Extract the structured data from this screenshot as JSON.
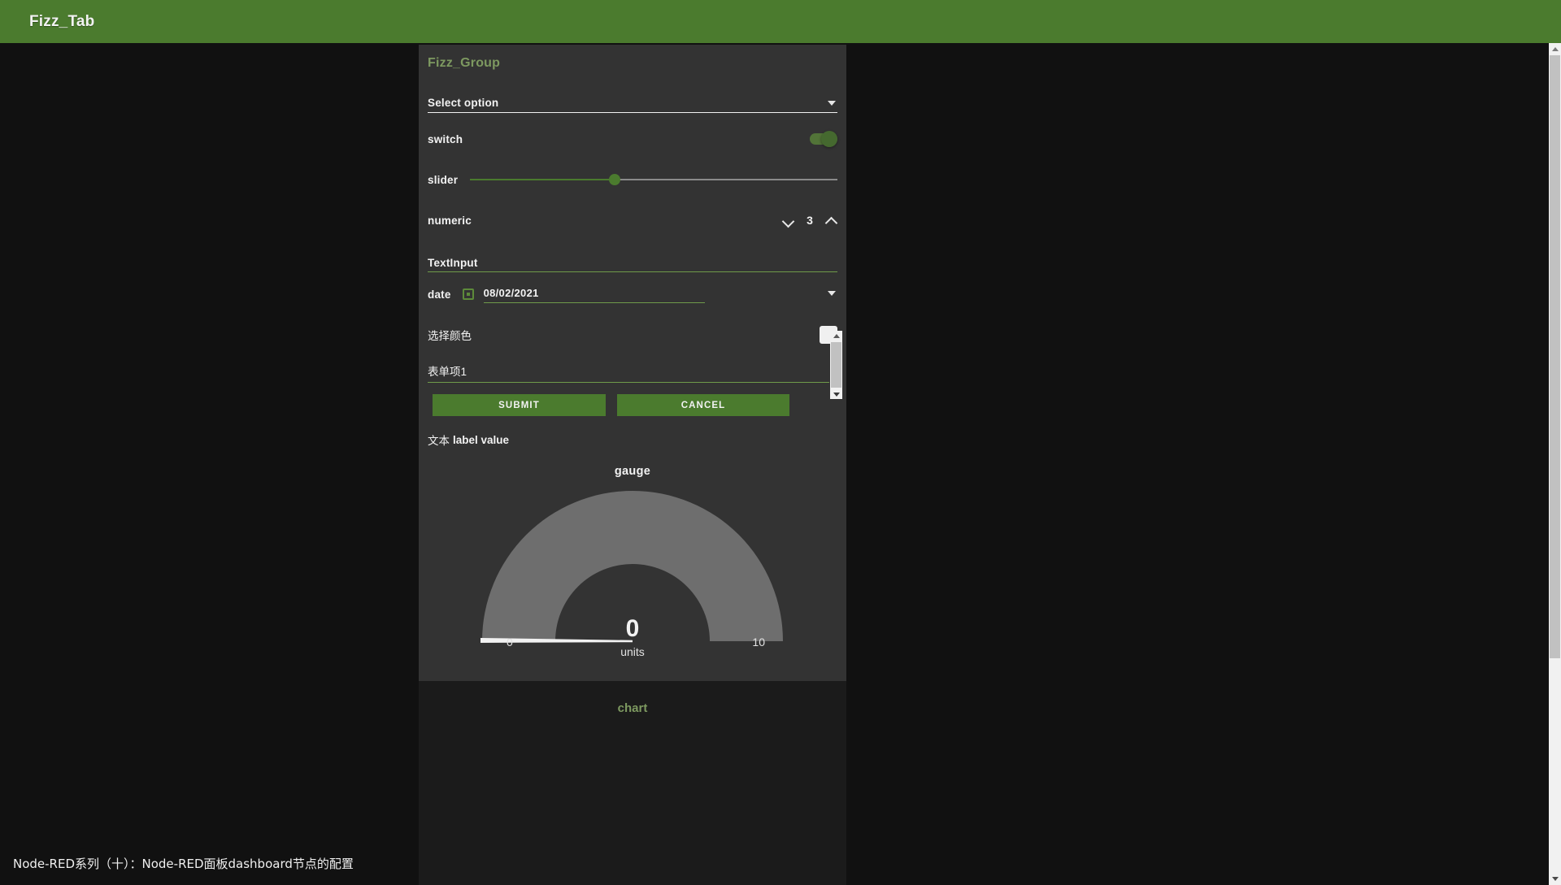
{
  "appbar": {
    "title": "Fizz_Tab"
  },
  "group": {
    "title": "Fizz_Group",
    "select": {
      "label": "Select option",
      "caret_icon": "chevron-down-icon"
    },
    "switch": {
      "label": "switch",
      "state": "on"
    },
    "slider": {
      "label": "slider",
      "value": 45,
      "min": 0,
      "max": 100
    },
    "numeric": {
      "label": "numeric",
      "value": "3",
      "down_icon": "chevron-down-icon",
      "up_icon": "chevron-up-icon"
    },
    "text_input": {
      "label": "TextInput",
      "value": ""
    },
    "date": {
      "label": "date",
      "value": "08/02/2021",
      "calendar_icon": "calendar-icon",
      "caret_icon": "chevron-down-icon"
    },
    "color": {
      "label": "选择颜色",
      "swatch": "#f0f0f0"
    },
    "form_item": {
      "label": "表单项1",
      "value": ""
    },
    "buttons": {
      "submit": "SUBMIT",
      "cancel": "CANCEL"
    },
    "text_widget": {
      "label": "文本",
      "value": "label value"
    }
  },
  "gauge": {
    "title": "gauge",
    "value": "0",
    "units": "units",
    "min_label": "0",
    "max_label": "10",
    "arc_color": "#6e6e6e",
    "needle_color": "#f2f2f2"
  },
  "chart_group": {
    "title": "chart"
  },
  "caption": {
    "text": "Node-RED系列（十）：Node-RED面板dashboard节点的配置"
  },
  "colors": {
    "accent": "#4b7b2e",
    "panel": "#333333",
    "canvas": "#111111",
    "group_title": "#7d9960"
  },
  "chart_data": {
    "type": "gauge",
    "title": "gauge",
    "value": 0,
    "min": 0,
    "max": 10,
    "units": "units",
    "categories": [
      "gauge"
    ],
    "values": [
      0
    ],
    "ylim": [
      0,
      10
    ],
    "xlabel": "",
    "ylabel": "units",
    "annotations": [
      "0",
      "units",
      "10"
    ]
  }
}
